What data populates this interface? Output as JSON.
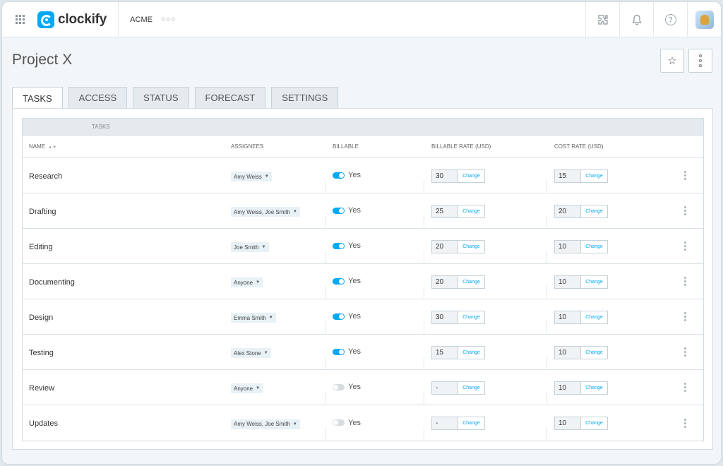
{
  "app": {
    "brand": "clockify",
    "workspace": "ACME",
    "accent": "#03a9f4"
  },
  "topbar": {
    "icons": [
      "apps-grid-icon",
      "puzzle-icon",
      "bell-icon",
      "help-icon",
      "avatar"
    ],
    "help_glyph": "?"
  },
  "page": {
    "title": "Project X",
    "star_glyph": "☆"
  },
  "tabs": [
    {
      "label": "TASKS",
      "active": true
    },
    {
      "label": "ACCESS",
      "active": false
    },
    {
      "label": "STATUS",
      "active": false
    },
    {
      "label": "FORECAST",
      "active": false
    },
    {
      "label": "SETTINGS",
      "active": false
    }
  ],
  "table": {
    "title": "TASKS",
    "columns": {
      "name": "NAME",
      "assignees": "ASSIGNEES",
      "billable": "BILLABLE",
      "billable_rate": "BILLABLE RATE (USD)",
      "cost_rate": "COST RATE (USD)"
    },
    "change_label": "Change",
    "rows": [
      {
        "name": "Research",
        "assignees": "Amy Weiss",
        "billable": true,
        "billable_label": "Yes",
        "billable_rate": "30",
        "cost_rate": "15"
      },
      {
        "name": "Drafting",
        "assignees": "Amy Weiss, Joe Smith",
        "billable": true,
        "billable_label": "Yes",
        "billable_rate": "25",
        "cost_rate": "20"
      },
      {
        "name": "Editing",
        "assignees": "Joe Smith",
        "billable": true,
        "billable_label": "Yes",
        "billable_rate": "20",
        "cost_rate": "10"
      },
      {
        "name": "Documenting",
        "assignees": "Anyone",
        "billable": true,
        "billable_label": "Yes",
        "billable_rate": "20",
        "cost_rate": "10"
      },
      {
        "name": "Design",
        "assignees": "Emma Smith",
        "billable": true,
        "billable_label": "Yes",
        "billable_rate": "30",
        "cost_rate": "10"
      },
      {
        "name": "Testing",
        "assignees": "Alex Stone",
        "billable": true,
        "billable_label": "Yes",
        "billable_rate": "15",
        "cost_rate": "10"
      },
      {
        "name": "Review",
        "assignees": "Anyone",
        "billable": false,
        "billable_label": "Yes",
        "billable_rate": "-",
        "cost_rate": "10"
      },
      {
        "name": "Updates",
        "assignees": "Amy Weiss, Joe Smith",
        "billable": false,
        "billable_label": "Yes",
        "billable_rate": "-",
        "cost_rate": "10"
      }
    ]
  }
}
